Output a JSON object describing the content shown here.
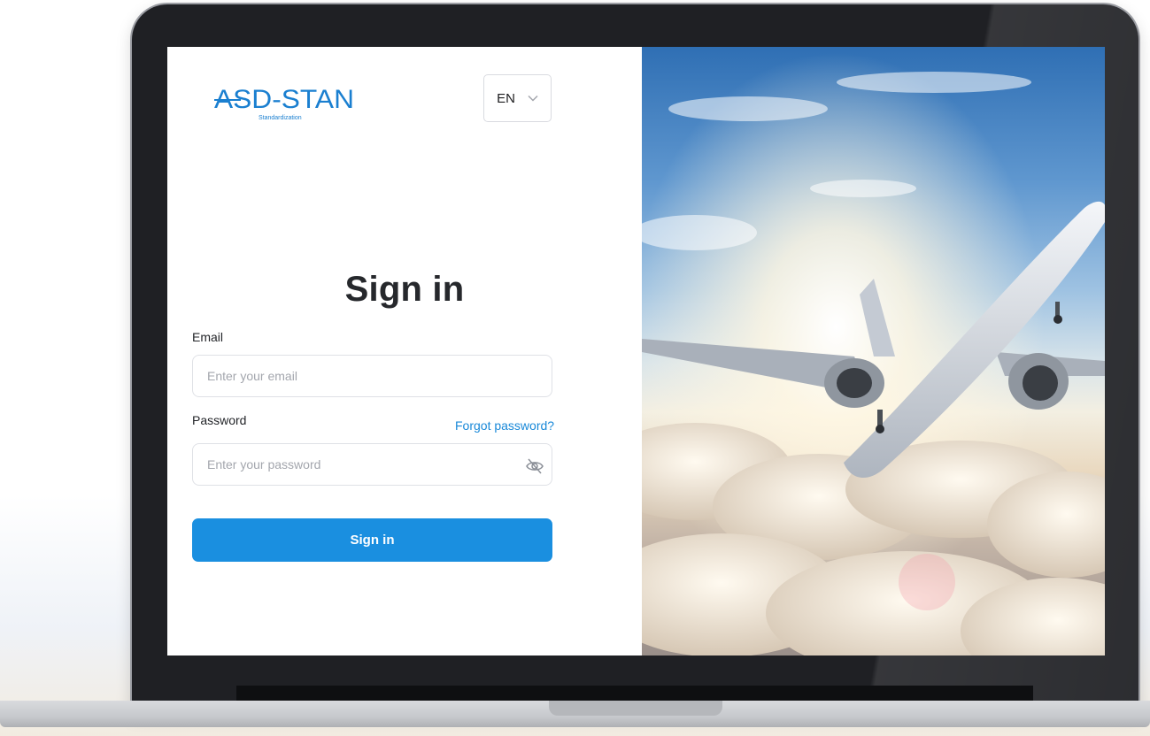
{
  "brand": {
    "logo_text": "ASD-STAN",
    "logo_tagline": "Standardization",
    "color": "#1a8fe0"
  },
  "language_select": {
    "value": "EN",
    "icon": "chevron-down-icon"
  },
  "signin": {
    "title": "Sign in",
    "email_label": "Email",
    "email_placeholder": "Enter your email",
    "password_label": "Password",
    "forgot_link": "Forgot password?",
    "password_placeholder": "Enter your password",
    "password_toggle_icon": "eye-off-icon",
    "submit_label": "Sign in"
  },
  "hero_image": {
    "subject": "airplane-flying-above-clouds"
  }
}
